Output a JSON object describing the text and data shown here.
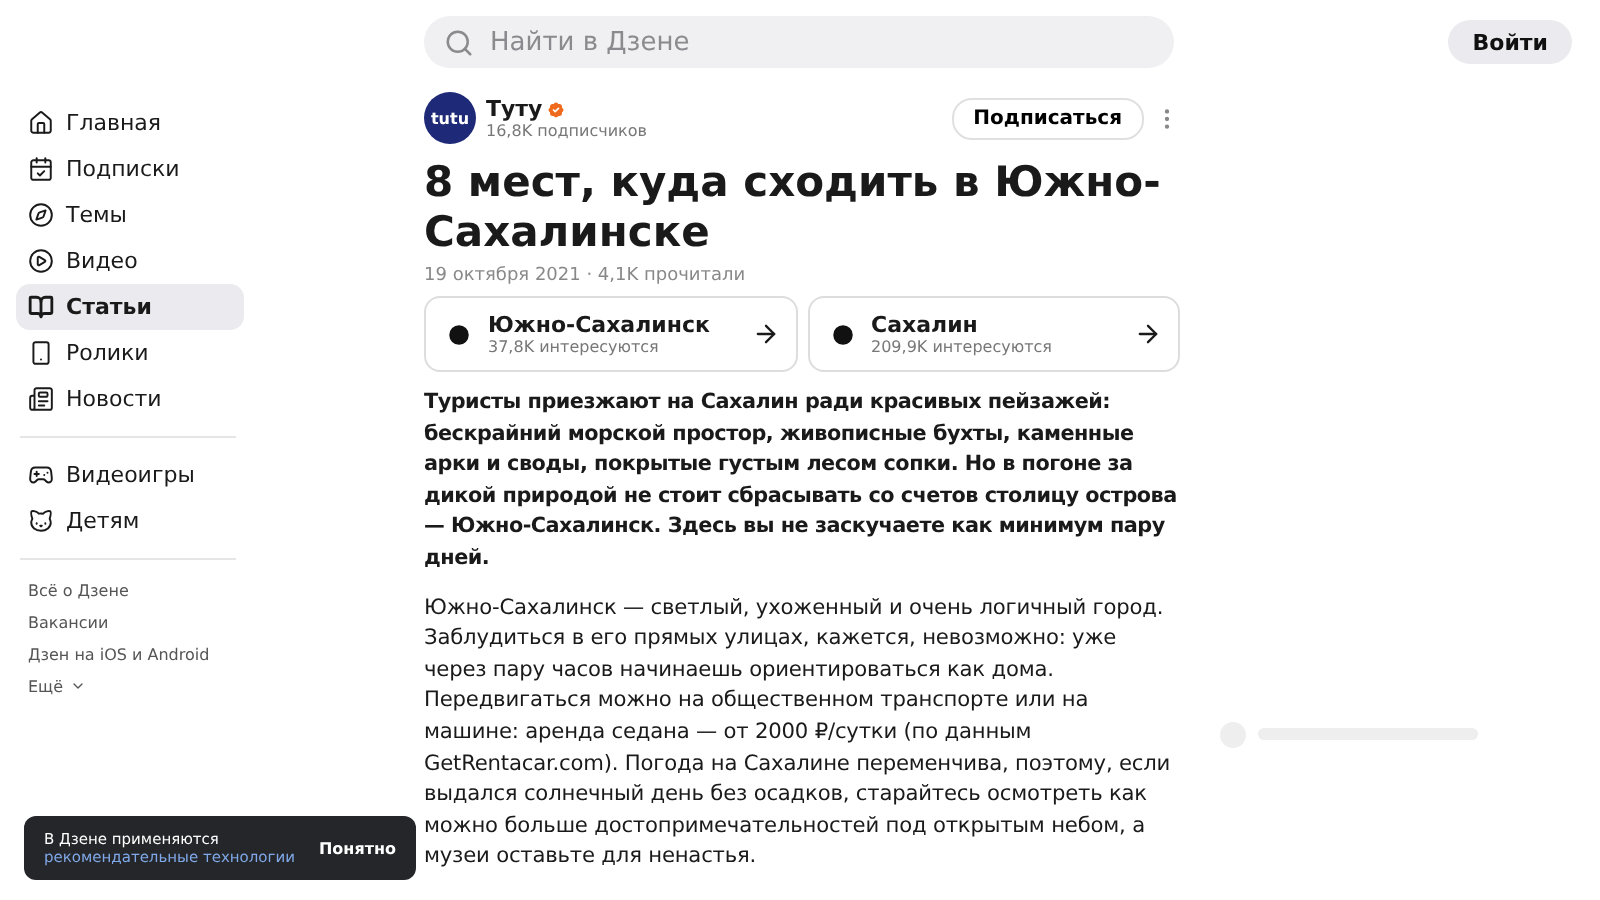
{
  "search": {
    "placeholder": "Найти в Дзене"
  },
  "login_button": "Войти",
  "sidebar": {
    "items": [
      {
        "label": "Главная",
        "selected": false
      },
      {
        "label": "Подписки",
        "selected": false
      },
      {
        "label": "Темы",
        "selected": false
      },
      {
        "label": "Видео",
        "selected": false
      },
      {
        "label": "Статьи",
        "selected": true
      },
      {
        "label": "Ролики",
        "selected": false
      },
      {
        "label": "Новости",
        "selected": false
      }
    ],
    "extra_items": [
      {
        "label": "Видеоигры",
        "selected": false
      },
      {
        "label": "Детям",
        "selected": false
      }
    ],
    "links": [
      "Всё о Дзене",
      "Вакансии",
      "Дзен на iOS и Android"
    ],
    "more": "Ещё"
  },
  "channel": {
    "logo_text": "tutu",
    "name": "Туту",
    "verified": true,
    "subscribers": "16,8K подписчиков",
    "subscribe_button": "Подписаться"
  },
  "article": {
    "title": "8 мест, куда сходить в Южно-Сахалинске",
    "meta": "19 октября 2021 · 4,1K прочитали",
    "topics": [
      {
        "name": "Южно-Сахалинск",
        "count": "37,8K интересуются"
      },
      {
        "name": "Сахалин",
        "count": "209,9K интересуются"
      }
    ],
    "lead": "Туристы приезжают на Сахалин ради красивых пейзажей: бескрайний морской простор, живописные бухты, каменные арки и своды, покрытые густым лесом сопки. Но в погоне за дикой природой не стоит сбрасывать со счетов столицу острова — Южно-Сахалинск. Здесь вы не заскучаете как минимум пару дней.",
    "body": "Южно-Сахалинск — светлый, ухоженный и очень логичный город. Заблудиться в его прямых улицах, кажется, невозможно: уже через пару часов начинаешь ориентироваться как дома. Передвигаться можно на общественном транспорте или на машине: аренда седана — от 2000 ₽/сутки (по данным GetRentacar.com). Погода на Сахалине переменчива, поэтому, если выдался солнечный день без осадков, старайтесь осмотреть как можно больше достопримечательностей под открытым небом, а музеи оставьте для ненастья."
  },
  "toast": {
    "text": "В Дзене применяются",
    "link": "рекомендательные технологии",
    "button": "Понятно"
  }
}
